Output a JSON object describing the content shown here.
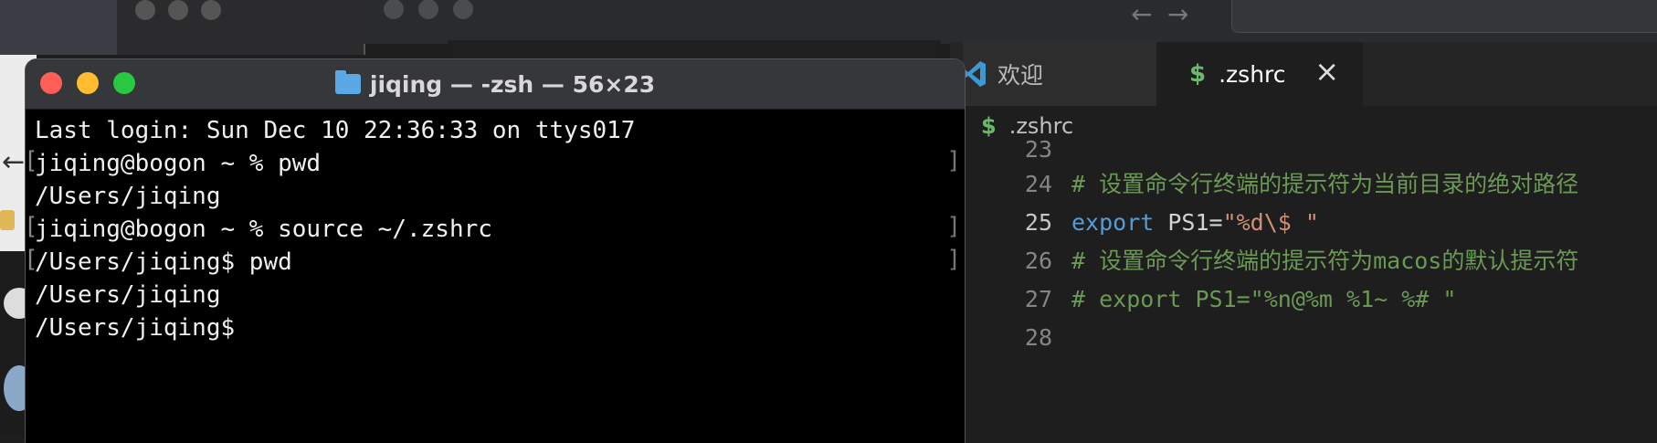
{
  "terminal": {
    "title": "jiqing — -zsh — 56×23",
    "lines": [
      "Last login: Sun Dec 10 22:36:33 on ttys017",
      "jiqing@bogon ~ % pwd",
      "/Users/jiqing",
      "jiqing@bogon ~ % source ~/.zshrc",
      "/Users/jiqing$ pwd",
      "/Users/jiqing",
      "/Users/jiqing$"
    ]
  },
  "editor": {
    "tabs": [
      {
        "label": "欢迎",
        "icon": "vscode-logo-icon"
      },
      {
        "label": ".zshrc",
        "icon": "dollar-icon"
      }
    ],
    "close_glyph": "×",
    "breadcrumb": ".zshrc",
    "dollar_glyph": "$",
    "lines": [
      {
        "num": "23"
      },
      {
        "num": "24",
        "comment": "# 设置命令行终端的提示符为当前目录的绝对路径"
      },
      {
        "num": "25",
        "kw": "export",
        "var": " PS1=",
        "str": "\"%d\\$ \""
      },
      {
        "num": "26",
        "comment": "# 设置命令行终端的提示符为macos的默认提示符"
      },
      {
        "num": "27",
        "comment": "# export PS1=\"%n@%m %1~ %# \""
      },
      {
        "num": "28"
      }
    ]
  },
  "nav": {
    "back_glyph": "←",
    "forward_glyph": "→"
  },
  "colors": {
    "terminal_bg": "#000000",
    "editor_bg": "#1e1e1e",
    "comment": "#6a9955",
    "keyword": "#569cd6",
    "string": "#ce9178",
    "traffic_red": "#ff5f57",
    "traffic_yellow": "#febc2e",
    "traffic_green": "#28c840"
  }
}
